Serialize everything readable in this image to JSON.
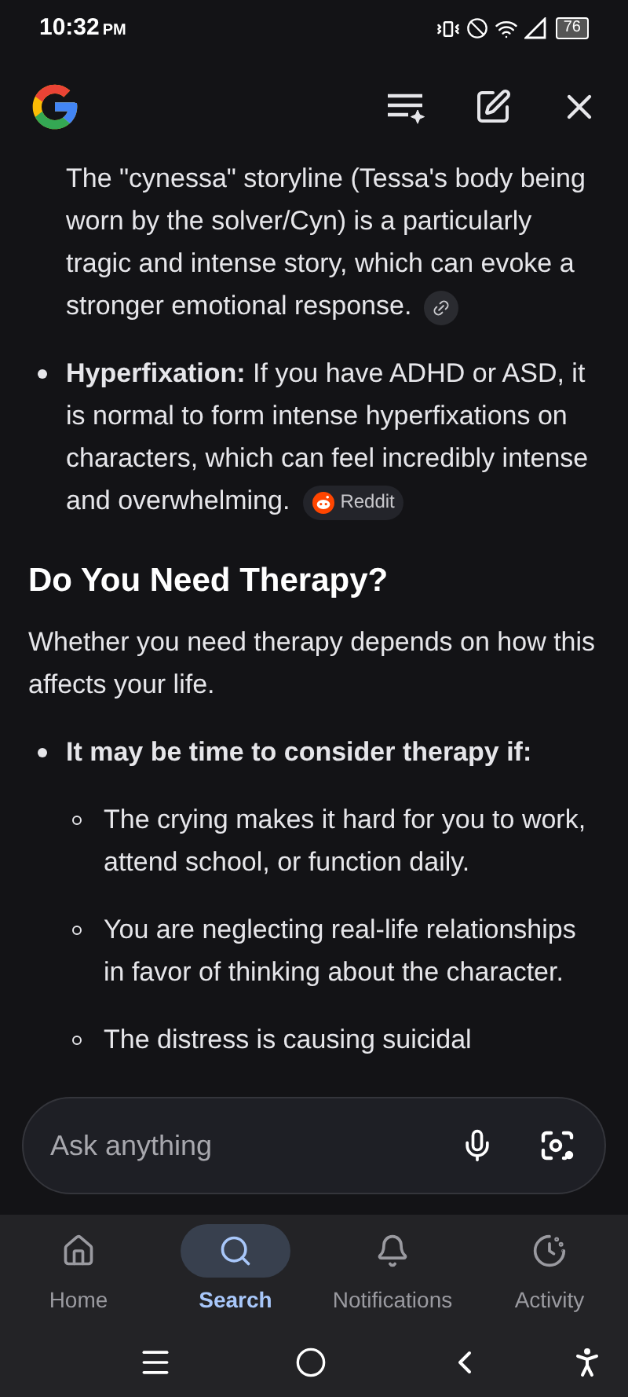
{
  "status_bar": {
    "time": "10:32",
    "ampm": "PM",
    "battery": "76"
  },
  "content": [
    {
      "kind": "continuation",
      "text": "The \"cynessa\" storyline (Tessa's body being worn by the solver/Cyn) is a particularly tragic and intense story, which can evoke a stronger emotional response.",
      "chip": {
        "kind": "link"
      }
    },
    {
      "kind": "bullet",
      "text": "**Hyperfixation:** If you have ADHD or ASD, it is normal to form intense hyperfixations on characters, which can feel incredibly intense and overwhelming.",
      "chip": {
        "kind": "source",
        "label": "Reddit"
      }
    },
    {
      "kind": "heading",
      "text": "Do You Need Therapy?"
    },
    {
      "kind": "paragraph",
      "text": "Whether you need therapy depends on how this affects your life."
    },
    {
      "kind": "bullet",
      "text": "**It may be time to consider therapy if:**",
      "children": [
        {
          "text": "The crying makes it hard for you to work, attend school, or function daily."
        },
        {
          "text": "You are neglecting real-life relationships in favor of thinking about the character."
        },
        {
          "text": "The distress is causing suicidal"
        }
      ]
    }
  ],
  "ask_bar": {
    "placeholder": "Ask anything"
  },
  "bottom_nav": [
    {
      "label": "Home",
      "kind": "home",
      "selected": false
    },
    {
      "label": "Search",
      "kind": "search",
      "selected": true
    },
    {
      "label": "Notifications",
      "kind": "bell",
      "selected": false
    },
    {
      "label": "Activity",
      "kind": "activity",
      "selected": false
    }
  ]
}
